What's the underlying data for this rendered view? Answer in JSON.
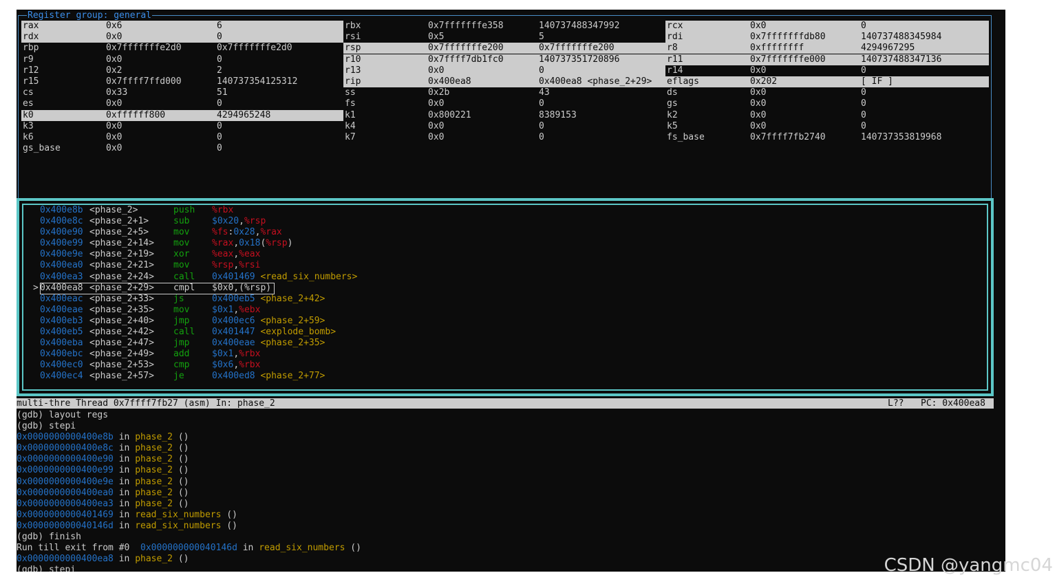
{
  "register_pane": {
    "title": "Register group: general",
    "rows": [
      [
        {
          "name": "rax",
          "hex": "0x6",
          "dec": "6",
          "hl": true
        },
        {
          "name": "rbx",
          "hex": "0x7fffffffe358",
          "dec": "140737488347992",
          "hl": false
        },
        {
          "name": "rcx",
          "hex": "0x0",
          "dec": "0",
          "hl": true
        }
      ],
      [
        {
          "name": "rdx",
          "hex": "0x0",
          "dec": "0",
          "hl": true
        },
        {
          "name": "rsi",
          "hex": "0x5",
          "dec": "5",
          "hl": false
        },
        {
          "name": "rdi",
          "hex": "0x7fffffffdb80",
          "dec": "140737488345984",
          "hl": true
        }
      ],
      [
        {
          "name": "rbp",
          "hex": "0x7fffffffe2d0",
          "dec": "0x7fffffffe2d0",
          "hl": false
        },
        {
          "name": "rsp",
          "hex": "0x7fffffffe200",
          "dec": "0x7fffffffe200",
          "hl": true
        },
        {
          "name": "r8",
          "hex": "0xffffffff",
          "dec": "4294967295",
          "hl": true
        }
      ],
      [
        {
          "name": "r9",
          "hex": "0x0",
          "dec": "0",
          "hl": false
        },
        {
          "name": "r10",
          "hex": "0x7ffff7db1fc0",
          "dec": "140737351720896",
          "hl": true
        },
        {
          "name": "r11",
          "hex": "0x7fffffffe000",
          "dec": "140737488347136",
          "hl": true
        }
      ],
      [
        {
          "name": "r12",
          "hex": "0x2",
          "dec": "2",
          "hl": false
        },
        {
          "name": "r13",
          "hex": "0x0",
          "dec": "0",
          "hl": true
        },
        {
          "name": "r14",
          "hex": "0x0",
          "dec": "0",
          "hl": false
        }
      ],
      [
        {
          "name": "r15",
          "hex": "0x7ffff7ffd000",
          "dec": "140737354125312",
          "hl": false
        },
        {
          "name": "rip",
          "hex": "0x400ea8",
          "dec": "0x400ea8 <phase_2+29>",
          "hl": true
        },
        {
          "name": "eflags",
          "hex": "0x202",
          "dec": "[ IF ]",
          "hl": true
        }
      ],
      [
        {
          "name": "cs",
          "hex": "0x33",
          "dec": "51",
          "hl": false
        },
        {
          "name": "ss",
          "hex": "0x2b",
          "dec": "43",
          "hl": false
        },
        {
          "name": "ds",
          "hex": "0x0",
          "dec": "0",
          "hl": false
        }
      ],
      [
        {
          "name": "es",
          "hex": "0x0",
          "dec": "0",
          "hl": false
        },
        {
          "name": "fs",
          "hex": "0x0",
          "dec": "0",
          "hl": false
        },
        {
          "name": "gs",
          "hex": "0x0",
          "dec": "0",
          "hl": false
        }
      ],
      [
        {
          "name": "k0",
          "hex": "0xffffff800",
          "dec": "4294965248",
          "hl": true
        },
        {
          "name": "k1",
          "hex": "0x800221",
          "dec": "8389153",
          "hl": false
        },
        {
          "name": "k2",
          "hex": "0x0",
          "dec": "0",
          "hl": false
        }
      ],
      [
        {
          "name": "k3",
          "hex": "0x0",
          "dec": "0",
          "hl": false
        },
        {
          "name": "k4",
          "hex": "0x0",
          "dec": "0",
          "hl": false
        },
        {
          "name": "k5",
          "hex": "0x0",
          "dec": "0",
          "hl": false
        }
      ],
      [
        {
          "name": "k6",
          "hex": "0x0",
          "dec": "0",
          "hl": false
        },
        {
          "name": "k7",
          "hex": "0x0",
          "dec": "0",
          "hl": false
        },
        {
          "name": "fs_base",
          "hex": "0x7ffff7fb2740",
          "dec": "140737353819968",
          "hl": false
        }
      ],
      [
        {
          "name": "gs_base",
          "hex": "0x0",
          "dec": "0",
          "hl": false
        }
      ]
    ]
  },
  "asm_pane": {
    "current_marker": ">",
    "rows": [
      {
        "addr": "0x400e8b",
        "sym": "<phase_2>",
        "op": "push",
        "args": [
          [
            "reg",
            "%rbx"
          ]
        ]
      },
      {
        "addr": "0x400e8c",
        "sym": "<phase_2+1>",
        "op": "sub",
        "args": [
          [
            "imm",
            "$0x20"
          ],
          [
            "pl",
            ","
          ],
          [
            "reg",
            "%rsp"
          ]
        ]
      },
      {
        "addr": "0x400e90",
        "sym": "<phase_2+5>",
        "op": "mov",
        "args": [
          [
            "reg",
            "%fs"
          ],
          [
            "pl",
            ":"
          ],
          [
            "imm",
            "0x28"
          ],
          [
            "pl",
            ","
          ],
          [
            "reg",
            "%rax"
          ]
        ]
      },
      {
        "addr": "0x400e99",
        "sym": "<phase_2+14>",
        "op": "mov",
        "args": [
          [
            "reg",
            "%rax"
          ],
          [
            "pl",
            ","
          ],
          [
            "imm",
            "0x18"
          ],
          [
            "pl",
            "("
          ],
          [
            "reg",
            "%rsp"
          ],
          [
            "pl",
            ")"
          ]
        ]
      },
      {
        "addr": "0x400e9e",
        "sym": "<phase_2+19>",
        "op": "xor",
        "args": [
          [
            "reg",
            "%eax"
          ],
          [
            "pl",
            ","
          ],
          [
            "reg",
            "%eax"
          ]
        ]
      },
      {
        "addr": "0x400ea0",
        "sym": "<phase_2+21>",
        "op": "mov",
        "args": [
          [
            "reg",
            "%rsp"
          ],
          [
            "pl",
            ","
          ],
          [
            "reg",
            "%rsi"
          ]
        ]
      },
      {
        "addr": "0x400ea3",
        "sym": "<phase_2+24>",
        "op": "call",
        "args": [
          [
            "imm",
            "0x401469"
          ],
          [
            "pl",
            " "
          ],
          [
            "sym",
            "<read_six_numbers>"
          ]
        ]
      },
      {
        "addr": "0x400ea8",
        "sym": "<phase_2+29>",
        "op": "cmpl",
        "args": [
          [
            "pl",
            "$0x0,(%rsp)"
          ]
        ],
        "current": true
      },
      {
        "addr": "0x400eac",
        "sym": "<phase_2+33>",
        "op": "js",
        "args": [
          [
            "imm",
            "0x400eb5"
          ],
          [
            "pl",
            " "
          ],
          [
            "sym",
            "<phase_2+42>"
          ]
        ]
      },
      {
        "addr": "0x400eae",
        "sym": "<phase_2+35>",
        "op": "mov",
        "args": [
          [
            "imm",
            "$0x1"
          ],
          [
            "pl",
            ","
          ],
          [
            "reg",
            "%ebx"
          ]
        ]
      },
      {
        "addr": "0x400eb3",
        "sym": "<phase_2+40>",
        "op": "jmp",
        "args": [
          [
            "imm",
            "0x400ec6"
          ],
          [
            "pl",
            " "
          ],
          [
            "sym",
            "<phase_2+59>"
          ]
        ]
      },
      {
        "addr": "0x400eb5",
        "sym": "<phase_2+42>",
        "op": "call",
        "args": [
          [
            "imm",
            "0x401447"
          ],
          [
            "pl",
            " "
          ],
          [
            "sym",
            "<explode_bomb>"
          ]
        ]
      },
      {
        "addr": "0x400eba",
        "sym": "<phase_2+47>",
        "op": "jmp",
        "args": [
          [
            "imm",
            "0x400eae"
          ],
          [
            "pl",
            " "
          ],
          [
            "sym",
            "<phase_2+35>"
          ]
        ]
      },
      {
        "addr": "0x400ebc",
        "sym": "<phase_2+49>",
        "op": "add",
        "args": [
          [
            "imm",
            "$0x1"
          ],
          [
            "pl",
            ","
          ],
          [
            "reg",
            "%rbx"
          ]
        ]
      },
      {
        "addr": "0x400ec0",
        "sym": "<phase_2+53>",
        "op": "cmp",
        "args": [
          [
            "imm",
            "$0x6"
          ],
          [
            "pl",
            ","
          ],
          [
            "reg",
            "%rbx"
          ]
        ]
      },
      {
        "addr": "0x400ec4",
        "sym": "<phase_2+57>",
        "op": "je",
        "args": [
          [
            "imm",
            "0x400ed8"
          ],
          [
            "pl",
            " "
          ],
          [
            "sym",
            "<phase_2+77>"
          ]
        ]
      }
    ]
  },
  "status_bar": {
    "left": "multi-thre Thread 0x7ffff7fb27 (asm) In: phase_2",
    "line": "L??",
    "pc": "PC: 0x400ea8"
  },
  "console": {
    "lines": [
      [
        [
          "pl",
          "(gdb) layout regs"
        ]
      ],
      [
        [
          "pl",
          "(gdb) stepi"
        ]
      ],
      [
        [
          "addr",
          "0x0000000000400e8b"
        ],
        [
          "pl",
          " in "
        ],
        [
          "func",
          "phase_2"
        ],
        [
          "pl",
          " ()"
        ]
      ],
      [
        [
          "addr",
          "0x0000000000400e8c"
        ],
        [
          "pl",
          " in "
        ],
        [
          "func",
          "phase_2"
        ],
        [
          "pl",
          " ()"
        ]
      ],
      [
        [
          "addr",
          "0x0000000000400e90"
        ],
        [
          "pl",
          " in "
        ],
        [
          "func",
          "phase_2"
        ],
        [
          "pl",
          " ()"
        ]
      ],
      [
        [
          "addr",
          "0x0000000000400e99"
        ],
        [
          "pl",
          " in "
        ],
        [
          "func",
          "phase_2"
        ],
        [
          "pl",
          " ()"
        ]
      ],
      [
        [
          "addr",
          "0x0000000000400e9e"
        ],
        [
          "pl",
          " in "
        ],
        [
          "func",
          "phase_2"
        ],
        [
          "pl",
          " ()"
        ]
      ],
      [
        [
          "addr",
          "0x0000000000400ea0"
        ],
        [
          "pl",
          " in "
        ],
        [
          "func",
          "phase_2"
        ],
        [
          "pl",
          " ()"
        ]
      ],
      [
        [
          "addr",
          "0x0000000000400ea3"
        ],
        [
          "pl",
          " in "
        ],
        [
          "func",
          "phase_2"
        ],
        [
          "pl",
          " ()"
        ]
      ],
      [
        [
          "addr",
          "0x0000000000401469"
        ],
        [
          "pl",
          " in "
        ],
        [
          "func",
          "read_six_numbers"
        ],
        [
          "pl",
          " ()"
        ]
      ],
      [
        [
          "addr",
          "0x000000000040146d"
        ],
        [
          "pl",
          " in "
        ],
        [
          "func",
          "read_six_numbers"
        ],
        [
          "pl",
          " ()"
        ]
      ],
      [
        [
          "pl",
          "(gdb) finish"
        ]
      ],
      [
        [
          "pl",
          "Run till exit from #0  "
        ],
        [
          "addr",
          "0x000000000040146d"
        ],
        [
          "pl",
          " in "
        ],
        [
          "func",
          "read_six_numbers"
        ],
        [
          "pl",
          " ()"
        ]
      ],
      [
        [
          "addr",
          "0x0000000000400ea8"
        ],
        [
          "pl",
          " in "
        ],
        [
          "func",
          "phase_2"
        ],
        [
          "pl",
          " ()"
        ]
      ],
      [
        [
          "pl",
          "(gdb) stepi"
        ]
      ]
    ]
  },
  "watermark": "CSDN @yangmc04",
  "colors": {
    "terminal_bg": "#0c0c0c",
    "address_blue": "#2472c8",
    "register_red": "#c50f1f",
    "opcode_green": "#13a10e",
    "symbol_yellow": "#c19c00",
    "frame_cyan": "#5cc7c7",
    "highlight_gray": "#cccccc"
  }
}
